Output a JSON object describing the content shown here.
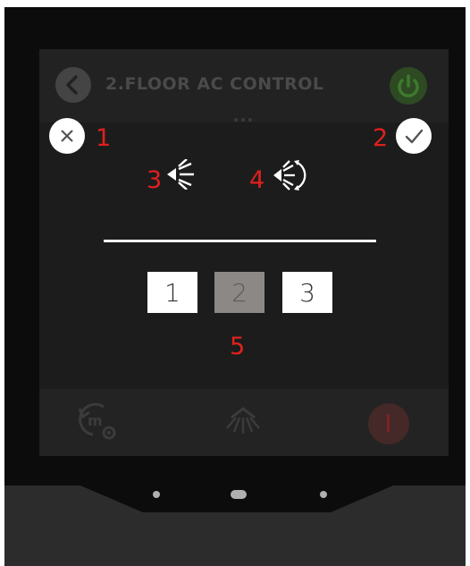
{
  "header": {
    "title": "2.FLOOR AC CONTROL"
  },
  "annotations": [
    "1",
    "2",
    "3",
    "4",
    "5"
  ],
  "fan_speed": {
    "options": [
      "1",
      "2",
      "3"
    ],
    "selected": "2"
  },
  "icons": {
    "back": "chevron-left-icon",
    "power": "power-icon",
    "cancel": "close-icon",
    "confirm": "check-icon",
    "fixed_direction": "fixed-airflow-icon",
    "swing_direction": "swing-airflow-icon",
    "schedule": "schedule-settings-icon",
    "swing": "louver-swing-icon",
    "off": "power-off-icon"
  },
  "colors": {
    "annotation": "#e0201e",
    "selected_speed": "#8c8886",
    "power_accent": "#2d4a22"
  }
}
